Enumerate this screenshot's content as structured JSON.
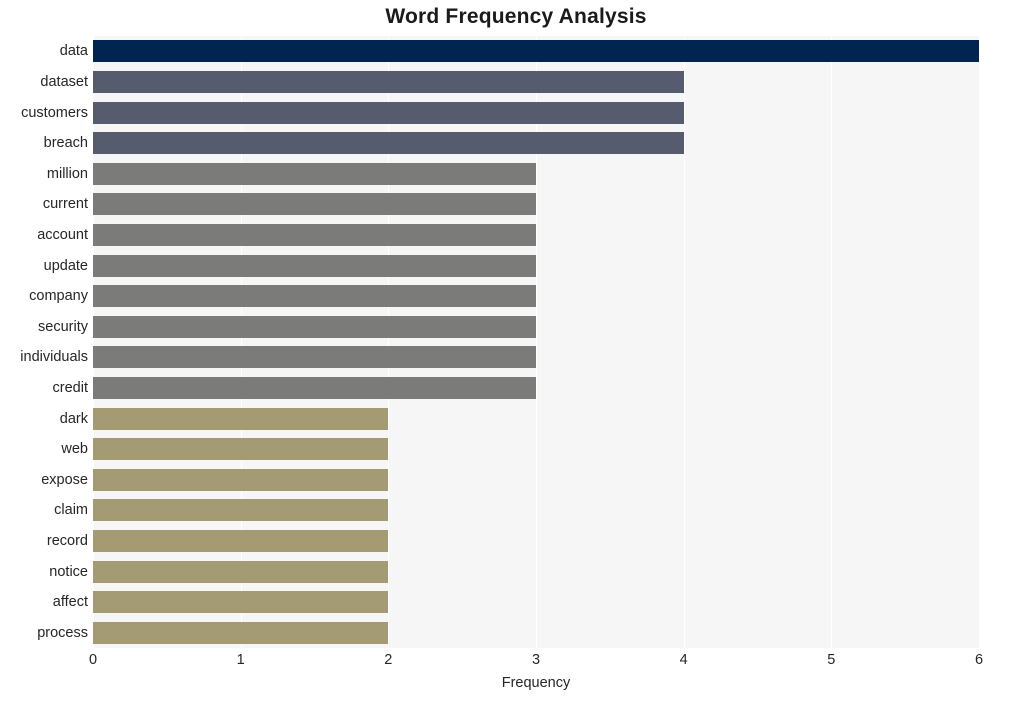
{
  "chart_data": {
    "type": "bar",
    "orientation": "horizontal",
    "title": "Word Frequency Analysis",
    "xlabel": "Frequency",
    "ylabel": "",
    "xlim": [
      0,
      6
    ],
    "xticks": [
      "0",
      "1",
      "2",
      "3",
      "4",
      "5",
      "6"
    ],
    "grid": true,
    "legend": false,
    "categories": [
      "data",
      "dataset",
      "customers",
      "breach",
      "million",
      "current",
      "account",
      "update",
      "company",
      "security",
      "individuals",
      "credit",
      "dark",
      "web",
      "expose",
      "claim",
      "record",
      "notice",
      "affect",
      "process"
    ],
    "values": [
      6,
      4,
      4,
      4,
      3,
      3,
      3,
      3,
      3,
      3,
      3,
      3,
      2,
      2,
      2,
      2,
      2,
      2,
      2,
      2
    ],
    "bar_colors": [
      "#012450",
      "#565b6d",
      "#565b6d",
      "#565b6d",
      "#7b7b79",
      "#7b7b79",
      "#7b7b79",
      "#7b7b79",
      "#7b7b79",
      "#7b7b79",
      "#7b7b79",
      "#7b7b79",
      "#a49a73",
      "#a49a73",
      "#a49a73",
      "#a49a73",
      "#a49a73",
      "#a49a73",
      "#a49a73",
      "#a49a73"
    ]
  },
  "style": {
    "plot_background": "#f6f6f7",
    "gridline_color": "#ffffff",
    "figure_background": "#ffffff",
    "text_color": "#262626"
  }
}
